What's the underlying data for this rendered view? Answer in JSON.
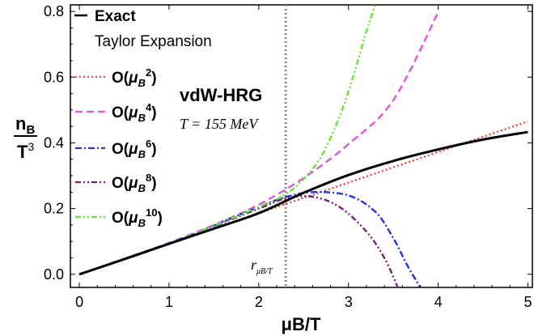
{
  "chart_data": {
    "type": "line",
    "title": "",
    "xlabel": "μB/T",
    "ylabel_num": "n",
    "ylabel_num_sub": "B",
    "ylabel_den": "T",
    "ylabel_den_sup": "3",
    "xlim": [
      -0.1,
      5.05
    ],
    "ylim": [
      -0.04,
      0.82
    ],
    "x_ticks": [
      0,
      1,
      2,
      3,
      4,
      5
    ],
    "x_tick_labels": [
      "0",
      "1",
      "2",
      "3",
      "4",
      "5"
    ],
    "y_ticks": [
      0.0,
      0.2,
      0.4,
      0.6,
      0.8
    ],
    "y_tick_labels": [
      "0.0",
      "0.2",
      "0.4",
      "0.6",
      "0.8"
    ],
    "grid": false,
    "legend_position": "top-left",
    "legend_header": "Taylor Expansion",
    "annotations": {
      "model": "vdW-HRG",
      "temperature": "T = 155 MeV",
      "vline_label_main": "r",
      "vline_label_sub": "μB/T",
      "vline_x": 2.3
    },
    "series": [
      {
        "name": "Exact",
        "label_order": "",
        "label_prefix": "Exact",
        "color": "#000000",
        "dash": "solid",
        "x": [
          0,
          0.5,
          1,
          1.5,
          2,
          2.5,
          3,
          3.5,
          4,
          4.5,
          5
        ],
        "y": [
          0,
          0.046,
          0.093,
          0.139,
          0.186,
          0.248,
          0.302,
          0.345,
          0.38,
          0.41,
          0.433
        ]
      },
      {
        "name": "O(μB2)",
        "label_prefix": "O(",
        "label_mu": "μ",
        "label_sub": "B",
        "label_sup": "2",
        "label_suffix": ")",
        "color": "#e8473c",
        "dash": "dot",
        "x": [
          0,
          1,
          2,
          3,
          4,
          5
        ],
        "y": [
          0,
          0.093,
          0.186,
          0.279,
          0.372,
          0.465
        ]
      },
      {
        "name": "O(μB4)",
        "label_prefix": "O(",
        "label_mu": "μ",
        "label_sub": "B",
        "label_sup": "4",
        "label_suffix": ")",
        "color": "#e055e0",
        "dash": "dash",
        "x": [
          0,
          0.5,
          1,
          1.5,
          2,
          2.5,
          3,
          3.5,
          4
        ],
        "y": [
          0,
          0.047,
          0.096,
          0.15,
          0.212,
          0.293,
          0.396,
          0.53,
          0.797
        ]
      },
      {
        "name": "O(μB6)",
        "label_prefix": "O(",
        "label_mu": "μ",
        "label_sub": "B",
        "label_sup": "6",
        "label_suffix": ")",
        "color": "#2233dd",
        "dash": "dashdot",
        "x": [
          0,
          1,
          2,
          2.3,
          2.6,
          3.0,
          3.3,
          3.5,
          3.65,
          3.8
        ],
        "y": [
          0,
          0.093,
          0.205,
          0.235,
          0.25,
          0.24,
          0.19,
          0.11,
          0.03,
          -0.04
        ]
      },
      {
        "name": "O(μB8)",
        "label_prefix": "O(",
        "label_mu": "μ",
        "label_sub": "B",
        "label_sup": "8",
        "label_suffix": ")",
        "color": "#771f77",
        "dash": "dashdotdot",
        "x": [
          0,
          1,
          2,
          2.3,
          2.6,
          2.9,
          3.2,
          3.4,
          3.55
        ],
        "y": [
          0,
          0.093,
          0.2,
          0.231,
          0.236,
          0.205,
          0.13,
          0.05,
          -0.04
        ]
      },
      {
        "name": "O(μB10)",
        "label_prefix": "O(",
        "label_mu": "μ",
        "label_sub": "B",
        "label_sup": "10",
        "label_suffix": ")",
        "color": "#66e633",
        "dash": "dashdotdot",
        "x": [
          0,
          1,
          2,
          2.3,
          2.5,
          2.7,
          2.9,
          3.05,
          3.2,
          3.3
        ],
        "y": [
          0,
          0.093,
          0.205,
          0.244,
          0.29,
          0.36,
          0.48,
          0.6,
          0.74,
          0.82
        ]
      }
    ]
  }
}
